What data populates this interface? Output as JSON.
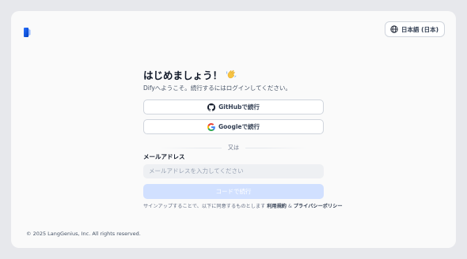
{
  "header": {
    "logo_icon": "dify-logo-icon",
    "language_label": "日本語 (日本)",
    "language_icon": "globe-icon"
  },
  "main": {
    "title": "はじめましょう！",
    "title_icon": "waving-hand-icon",
    "subtitle": "Difyへようこそ。続行するにはログインしてください。",
    "github_label": "GitHubで続行",
    "github_icon": "github-icon",
    "google_label": "Googleで続行",
    "google_icon": "google-icon",
    "divider_text": "又は",
    "email_label": "メールアドレス",
    "email_placeholder": "メールアドレスを入力してください",
    "email_value": "",
    "submit_label": "コードで続行",
    "terms_prefix": "サインアップすることで、以下に同意するものとします",
    "terms_link": "利用規約",
    "terms_and": "&",
    "privacy_link": "プライバシーポリシー"
  },
  "footer": {
    "copyright": "© 2025 LangGenius, Inc. All rights reserved."
  },
  "colors": {
    "page_bg": "#e7e8ec",
    "card_bg": "#fafafa",
    "primary_disabled": "#d1e0ff",
    "logo_blue": "#155eef"
  }
}
